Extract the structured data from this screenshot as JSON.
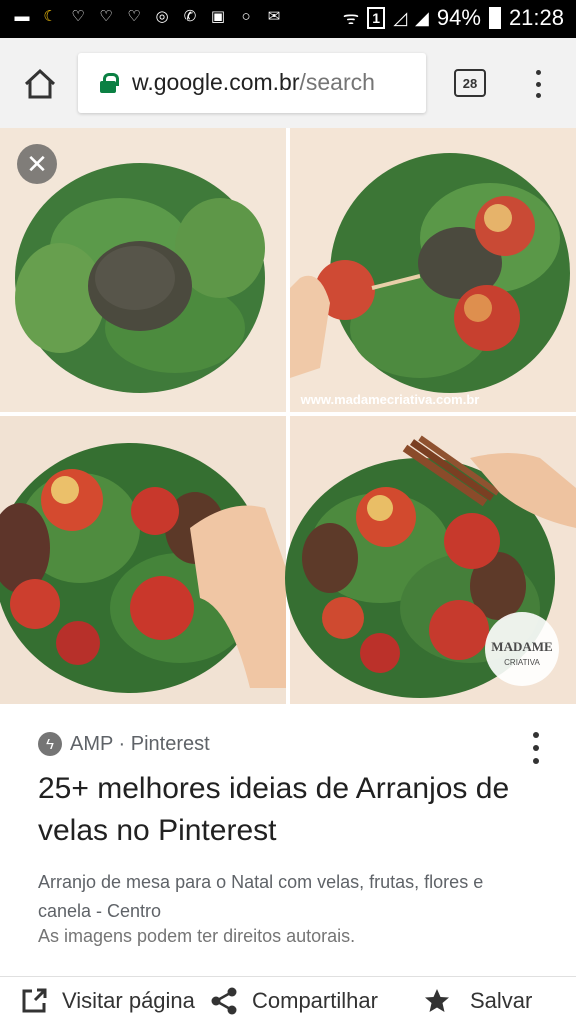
{
  "status_bar": {
    "sim_label": "1",
    "battery_percent": "94%",
    "time": "21:28",
    "icons": [
      "message-icon",
      "moon-icon",
      "heart-icon",
      "heart-icon",
      "heart-icon",
      "instagram-icon",
      "whatsapp-icon",
      "gallery-icon",
      "circle-icon",
      "mail-icon",
      "wifi-icon",
      "signal-icon",
      "battery-icon"
    ]
  },
  "browser": {
    "url_domain": "w.google.com.br",
    "url_path": "/search",
    "tab_count": "28"
  },
  "image": {
    "watermark": "www.madamecriativa.com.br",
    "logo_text_1": "MADAME",
    "logo_text_2": "CRIATIVA"
  },
  "result": {
    "source_label": "AMP · Pinterest",
    "title": "25+ melhores ideias de Arranjos de velas no Pinterest",
    "description": "Arranjo de mesa para o Natal com velas, frutas, flores e canela - Centro",
    "rights_notice": "As imagens podem ter direitos autorais."
  },
  "actions": {
    "visit_label": "Visitar página",
    "share_label": "Compartilhar",
    "save_label": "Salvar"
  }
}
